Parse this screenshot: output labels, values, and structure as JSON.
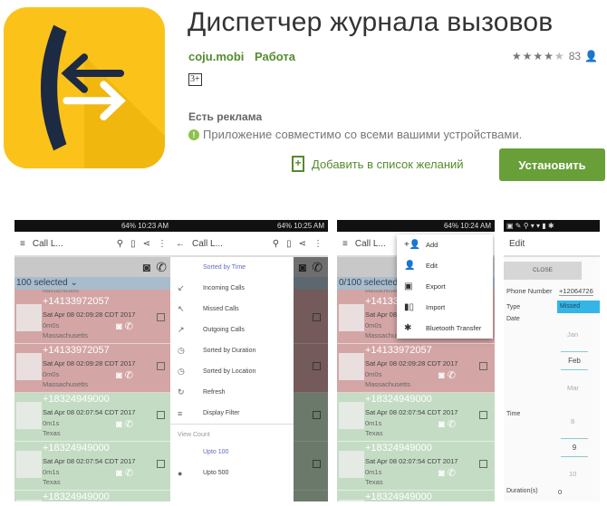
{
  "app": {
    "title": "Диспетчер журнала вызовов",
    "developer": "coju.mobi",
    "category": "Работа",
    "rating_stars": 4.5,
    "rating_count": "83",
    "age_rating": "3+",
    "ads_notice": "Есть реклама",
    "compat": "Приложение совместимо со всеми вашими устройствами.",
    "wishlist_label": "Добавить в список желаний",
    "install_label": "Установить",
    "accent": "#689f38",
    "icon_bg": "#fbc21a"
  },
  "screens": [
    {
      "time": "64% 10:23 AM",
      "toolbar_title": "Call L...",
      "selected": "100 selected",
      "top_partial": "Massachusetts",
      "rows": [
        {
          "type": "missed",
          "number": "+14133972057",
          "date": "Sat Apr 08 02:09:28 CDT 2017",
          "duration": "0m0s",
          "location": "Massachusetts"
        },
        {
          "type": "missed",
          "number": "+14133972057",
          "date": "Sat Apr 08 02:09:28 CDT 2017",
          "duration": "0m0s",
          "location": "Massachusetts"
        },
        {
          "type": "out",
          "number": "+18324949000",
          "date": "Sat Apr 08 02:07:54 CDT 2017",
          "duration": "0m1s",
          "location": "Texas"
        },
        {
          "type": "out",
          "number": "+18324949000",
          "date": "Sat Apr 08 02:07:54 CDT 2017",
          "duration": "0m1s",
          "location": "Texas"
        },
        {
          "type": "out",
          "number": "+18324949000",
          "date": "",
          "duration": "",
          "location": ""
        }
      ]
    },
    {
      "time": "64% 10:25 AM",
      "toolbar_title": "Call L...",
      "drawer": [
        {
          "icon": "",
          "label": "Sorted by Time",
          "active": true
        },
        {
          "icon": "↙",
          "label": "Incoming Calls"
        },
        {
          "icon": "↖",
          "label": "Missed Calls"
        },
        {
          "icon": "↗",
          "label": "Outgoing Calls"
        },
        {
          "icon": "◷",
          "label": "Sorted by Duration"
        },
        {
          "icon": "◷",
          "label": "Sorted by Location"
        },
        {
          "icon": "↻",
          "label": "Refresh"
        },
        {
          "icon": "≡",
          "label": "Display Filter"
        }
      ],
      "view_count_label": "View Count",
      "view_counts": [
        {
          "icon": "",
          "label": "Upto 100",
          "active": true
        },
        {
          "icon": "●",
          "label": "Upto 500"
        }
      ]
    },
    {
      "time": "64% 10:24 AM",
      "toolbar_title": "Call L...",
      "selected": "0/100 selected",
      "menu": [
        {
          "icon": "+👤",
          "label": "Add"
        },
        {
          "icon": "👤",
          "label": "Edit"
        },
        {
          "icon": "▣",
          "label": "Export"
        },
        {
          "icon": "▮▯",
          "label": "Import"
        },
        {
          "icon": "✱",
          "label": "Bluetooth Transfer"
        }
      ]
    },
    {
      "toolbar_title": "Edit",
      "close_label": "CLOSE",
      "phone_label": "Phone Number",
      "phone_value": "+12064726",
      "type_label": "Type",
      "type_value": "Missed",
      "date_label": "Date",
      "months": [
        "Jan",
        "Feb",
        "Mar"
      ],
      "time_label": "Time",
      "hours": [
        "8",
        "9",
        "10"
      ],
      "duration_label": "Duration(s)",
      "duration_value": "0"
    }
  ]
}
